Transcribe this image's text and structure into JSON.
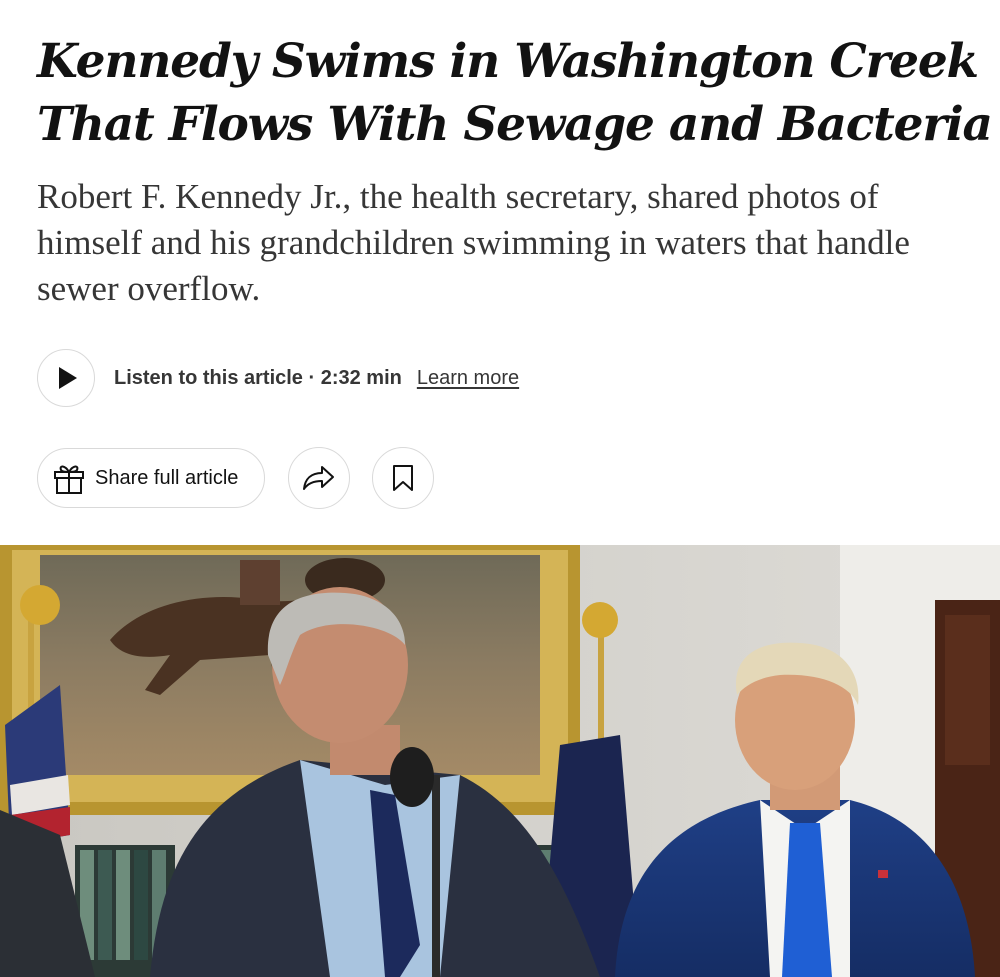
{
  "article": {
    "headline_line1": "Kennedy Swims in Washington Creek",
    "headline_line2": "That Flows With Sewage and Bacteria",
    "summary": "Robert F. Kennedy Jr., the health secretary, shared photos of himself and his grandchildren swimming in waters that handle sewer overflow."
  },
  "audio": {
    "listen_label": "Listen to this article · 2:32 min",
    "learn_more": "Learn more"
  },
  "actions": {
    "share_label": "Share full article",
    "share_icon": "gift-icon",
    "forward_icon": "share-arrow-icon",
    "save_icon": "bookmark-icon"
  },
  "colors": {
    "text": "#121212",
    "summary_text": "#363636",
    "button_border": "#d9d9d9"
  }
}
